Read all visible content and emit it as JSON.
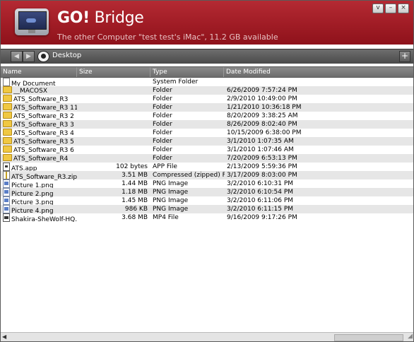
{
  "app": {
    "title_bold": "GO!",
    "title_rest": " Bridge",
    "subtitle": "The other Computer \"test test's iMac\", 11.2 GB available"
  },
  "window_controls": {
    "dropdown": "v",
    "minimize": "–",
    "close": "×"
  },
  "toolbar": {
    "back": "◀",
    "forward": "▶",
    "path": "Desktop",
    "add": "+"
  },
  "columns": {
    "name": "Name",
    "size": "Size",
    "type": "Type",
    "date": "Date Modified"
  },
  "files": [
    {
      "icon": "doc-icon",
      "kind": "doc",
      "name": "My Document",
      "size": "",
      "type": "System Folder",
      "date": ""
    },
    {
      "icon": "folder-icon",
      "kind": "folder",
      "name": "__MACOSX",
      "size": "",
      "type": "Folder",
      "date": "6/26/2009 7:57:24 PM"
    },
    {
      "icon": "folder-icon",
      "kind": "folder",
      "name": "ATS_Software_R3",
      "size": "",
      "type": "Folder",
      "date": "2/9/2010 10:49:00 PM"
    },
    {
      "icon": "folder-icon",
      "kind": "folder",
      "name": "ATS_Software_R3 11",
      "size": "",
      "type": "Folder",
      "date": "1/21/2010 10:36:18 PM"
    },
    {
      "icon": "folder-icon",
      "kind": "folder",
      "name": "ATS_Software_R3 2",
      "size": "",
      "type": "Folder",
      "date": "8/20/2009 3:38:25 AM"
    },
    {
      "icon": "folder-icon",
      "kind": "folder",
      "name": "ATS_Software_R3 3",
      "size": "",
      "type": "Folder",
      "date": "8/26/2009 8:02:40 PM"
    },
    {
      "icon": "folder-icon",
      "kind": "folder",
      "name": "ATS_Software_R3 4",
      "size": "",
      "type": "Folder",
      "date": "10/15/2009 6:38:00 PM"
    },
    {
      "icon": "folder-icon",
      "kind": "folder",
      "name": "ATS_Software_R3 5",
      "size": "",
      "type": "Folder",
      "date": "3/1/2010 1:07:35 AM"
    },
    {
      "icon": "folder-icon",
      "kind": "folder",
      "name": "ATS_Software_R3 6",
      "size": "",
      "type": "Folder",
      "date": "3/1/2010 1:07:46 AM"
    },
    {
      "icon": "folder-icon",
      "kind": "folder",
      "name": "ATS_Software_R4",
      "size": "",
      "type": "Folder",
      "date": "7/20/2009 6:53:13 PM"
    },
    {
      "icon": "app-icon",
      "kind": "app",
      "name": "ATS.app",
      "size": "102 bytes",
      "type": "APP File",
      "date": "2/13/2009 5:59:36 PM"
    },
    {
      "icon": "zip-icon",
      "kind": "zip",
      "name": "ATS_Software_R3.zip",
      "size": "3.51 MB",
      "type": "Compressed (zipped) Fold",
      "date": "3/17/2009 8:03:00 PM"
    },
    {
      "icon": "image-icon",
      "kind": "png",
      "name": "Picture 1.png",
      "size": "1.44 MB",
      "type": "PNG Image",
      "date": "3/2/2010 6:10:31 PM"
    },
    {
      "icon": "image-icon",
      "kind": "png",
      "name": "Picture 2.png",
      "size": "1.18 MB",
      "type": "PNG Image",
      "date": "3/2/2010 6:10:54 PM"
    },
    {
      "icon": "image-icon",
      "kind": "png",
      "name": "Picture 3.png",
      "size": "1.45 MB",
      "type": "PNG Image",
      "date": "3/2/2010 6:11:06 PM"
    },
    {
      "icon": "image-icon",
      "kind": "png",
      "name": "Picture 4.png",
      "size": "986 KB",
      "type": "PNG Image",
      "date": "3/2/2010 6:11:15 PM"
    },
    {
      "icon": "video-icon",
      "kind": "mp4",
      "name": "Shakira-SheWolf-HQ.r",
      "size": "3.68 MB",
      "type": "MP4 File",
      "date": "9/16/2009 9:17:26 PM"
    }
  ]
}
